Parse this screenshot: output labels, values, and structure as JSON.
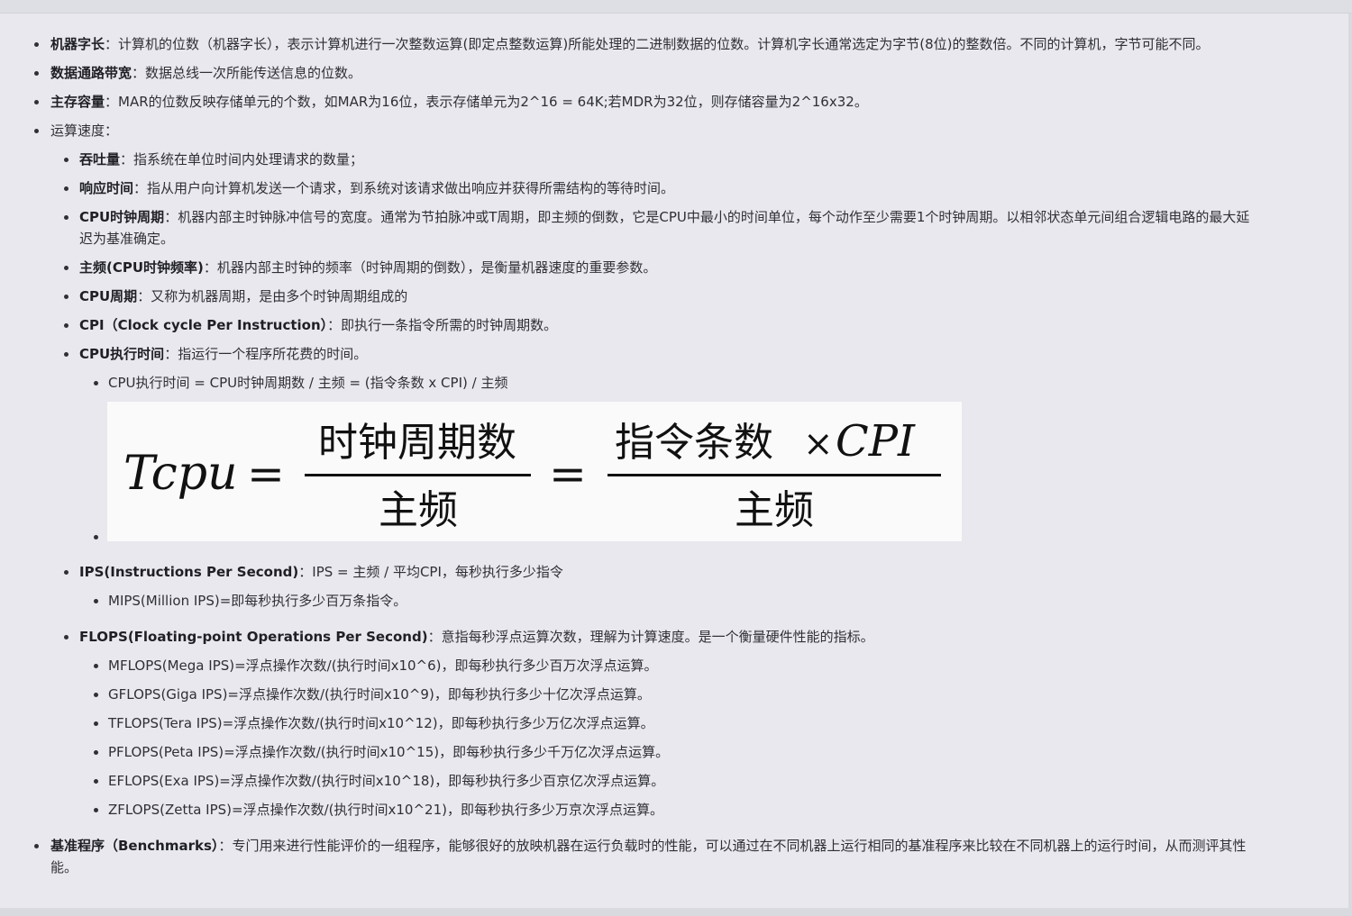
{
  "items": {
    "word_len": {
      "term": "机器字长",
      "sep": "：",
      "desc": "计算机的位数（机器字长），表示计算机进行一次整数运算(即定点整数运算)所能处理的二进制数据的位数。计算机字长通常选定为字节(8位)的整数倍。不同的计算机，字节可能不同。"
    },
    "bandwidth": {
      "term": "数据通路带宽",
      "sep": "：",
      "desc": "数据总线一次所能传送信息的位数。"
    },
    "capacity": {
      "term": "主存容量",
      "sep": "：",
      "desc": "MAR的位数反映存储单元的个数，如MAR为16位，表示存储单元为2^16 = 64K;若MDR为32位，则存储容量为2^16x32。"
    },
    "speed": {
      "label": "运算速度："
    },
    "throughput": {
      "term": "吞吐量",
      "sep": "：",
      "desc": "指系统在单位时间内处理请求的数量；"
    },
    "response": {
      "term": "响应时间",
      "sep": "：",
      "desc": "指从用户向计算机发送一个请求，到系统对该请求做出响应并获得所需结构的等待时间。"
    },
    "clock_cycle": {
      "term": "CPU时钟周期",
      "sep": "：",
      "desc_line1": "机器内部主时钟脉冲信号的宽度。通常为节拍脉冲或T周期，即主频的倒数，它是CPU中最小的时间单位，每个动作至少需要1个时钟周期。以相邻状态单元间组合逻辑电路的最大延",
      "desc_line2": "迟为基准确定。"
    },
    "freq": {
      "term": "主频(CPU时钟频率)",
      "sep": "：",
      "desc": "机器内部主时钟的频率（时钟周期的倒数），是衡量机器速度的重要参数。"
    },
    "cpu_cycle": {
      "term": "CPU周期",
      "sep": "：",
      "desc": "又称为机器周期，是由多个时钟周期组成的"
    },
    "cpi": {
      "term": "CPI（Clock cycle Per Instruction）",
      "sep": "：",
      "desc": "即执行一条指令所需的时钟周期数。"
    },
    "exec_time": {
      "term": "CPU执行时间",
      "sep": "：",
      "desc": "指运行一个程序所花费的时间。",
      "sub": "CPU执行时间 = CPU时钟周期数 / 主频 = (指令条数 x CPI) / 主频"
    },
    "ips": {
      "term": "IPS(Instructions Per Second)",
      "sep": "：",
      "desc": "IPS = 主频 / 平均CPI，每秒执行多少指令",
      "sub": "MIPS(Million IPS)=即每秒执行多少百万条指令。"
    },
    "flops": {
      "term": "FLOPS(Floating-point Operations Per Second)",
      "sep": "：",
      "desc": "意指每秒浮点运算次数，理解为计算速度。是一个衡量硬件性能的指标。",
      "subs": [
        "MFLOPS(Mega IPS)=浮点操作次数/(执行时间x10^6)，即每秒执行多少百万次浮点运算。",
        "GFLOPS(Giga IPS)=浮点操作次数/(执行时间x10^9)，即每秒执行多少十亿次浮点运算。",
        "TFLOPS(Tera IPS)=浮点操作次数/(执行时间x10^12)，即每秒执行多少万亿次浮点运算。",
        "PFLOPS(Peta IPS)=浮点操作次数/(执行时间x10^15)，即每秒执行多少千万亿次浮点运算。",
        "EFLOPS(Exa IPS)=浮点操作次数/(执行时间x10^18)，即每秒执行多少百京亿次浮点运算。",
        "ZFLOPS(Zetta IPS)=浮点操作次数/(执行时间x10^21)，即每秒执行多少万京次浮点运算。"
      ]
    },
    "benchmark": {
      "term": "基准程序（Benchmarks）",
      "sep": "：",
      "desc_line1": "专门用来进行性能评价的一组程序，能够很好的放映机器在运行负载时的性能，可以通过在不同机器上运行相同的基准程序来比较在不同机器上的运行时间，从而测评其性",
      "desc_line2": "能。"
    }
  },
  "formula": {
    "lhs": "Tcpu",
    "eq": "=",
    "num1": "时钟周期数",
    "den1": "主频",
    "num2_cn": "指令条数",
    "num2_times": "×",
    "num2_cpi": "CPI",
    "den2": "主频"
  }
}
